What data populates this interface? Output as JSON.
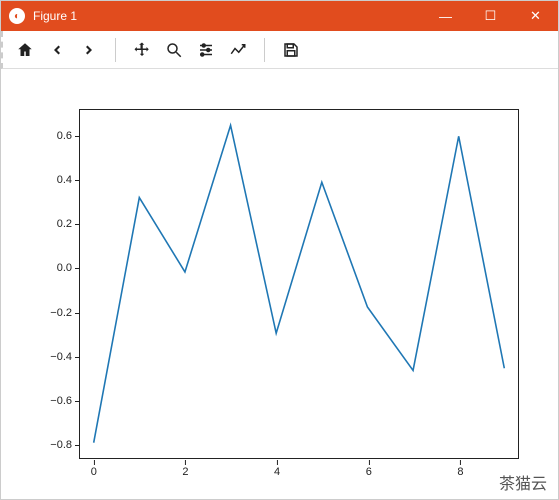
{
  "window": {
    "title": "Figure 1",
    "minimize": "—",
    "maximize": "☐",
    "close": "✕"
  },
  "toolbar": {
    "home": "home-icon",
    "back": "back-icon",
    "forward": "forward-icon",
    "pan": "pan-icon",
    "zoom": "zoom-icon",
    "configure": "configure-icon",
    "edit": "edit-icon",
    "save": "save-icon"
  },
  "watermark": "茶猫云",
  "chart_data": {
    "type": "line",
    "x": [
      0,
      1,
      2,
      3,
      4,
      5,
      6,
      7,
      8,
      9
    ],
    "values": [
      -0.8,
      0.32,
      -0.02,
      0.65,
      -0.3,
      0.39,
      -0.18,
      -0.47,
      0.6,
      -0.46
    ],
    "xlabel": "",
    "ylabel": "",
    "title": "",
    "xlim": [
      -0.3,
      9.3
    ],
    "ylim": [
      -0.87,
      0.72
    ],
    "yticks": [
      -0.8,
      -0.6,
      -0.4,
      -0.2,
      0.0,
      0.2,
      0.4,
      0.6
    ],
    "xticks": [
      0,
      2,
      4,
      6,
      8
    ],
    "line_color": "#1f77b4"
  }
}
